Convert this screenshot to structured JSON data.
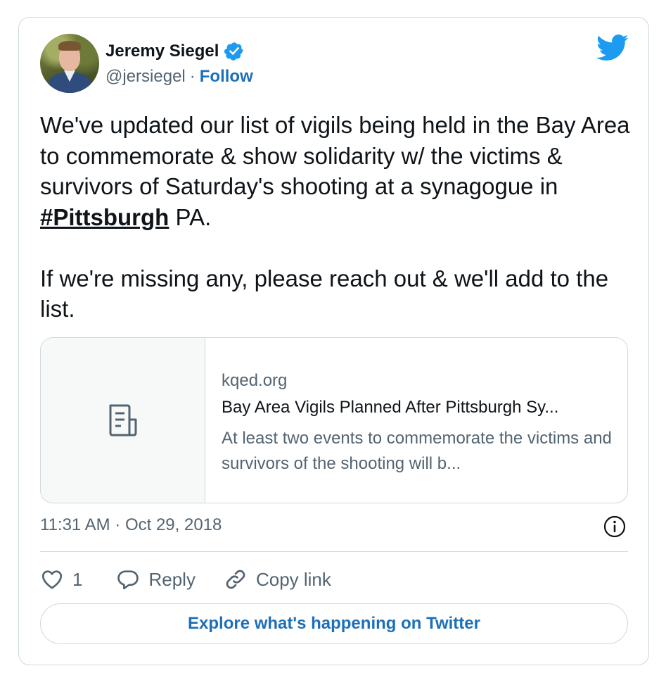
{
  "author": {
    "name": "Jeremy Siegel",
    "handle": "@jersiegel",
    "separator": "·",
    "follow_label": "Follow",
    "verified": true
  },
  "tweet": {
    "text_part1": "We've updated our list of vigils being held in the Bay Area to commemorate & show solidarity w/ the victims & survivors of Saturday's shooting at a synagogue in ",
    "hashtag": "#Pittsburgh",
    "text_part2": " PA.\n\nIf we're missing any, please reach out & we'll add to the list."
  },
  "link_card": {
    "domain": "kqed.org",
    "title": "Bay Area Vigils Planned After Pittsburgh Sy...",
    "description": "At least two events to commemorate the victims and survivors of the shooting will b...",
    "thumbnail_icon": "document-icon"
  },
  "timestamp": "11:31 AM · Oct 29, 2018",
  "actions": {
    "like_count": "1",
    "reply_label": "Reply",
    "copy_link_label": "Copy link"
  },
  "explore_label": "Explore what's happening on Twitter",
  "colors": {
    "accent": "#1d6fb8",
    "twitter_blue": "#1d9bf0",
    "text": "#0f1419",
    "secondary": "#536471",
    "border": "#cfd9de"
  },
  "icons": [
    "verified-badge-icon",
    "twitter-bird-icon",
    "document-icon",
    "info-icon",
    "heart-icon",
    "reply-icon",
    "link-icon"
  ]
}
